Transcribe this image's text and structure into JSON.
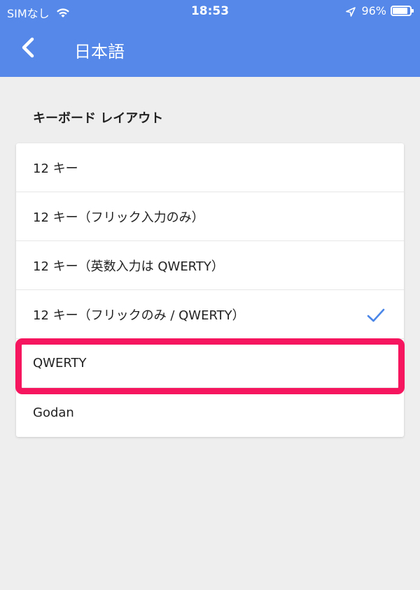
{
  "status_bar": {
    "carrier": "SIMなし",
    "time": "18:53",
    "battery_percent": "96%",
    "battery_level": 0.96,
    "icons": [
      "wifi-icon",
      "location-icon",
      "battery-icon"
    ]
  },
  "app_bar": {
    "title": "日本語",
    "back_icon": "chevron-left-icon"
  },
  "section": {
    "title": "キーボード レイアウト"
  },
  "options": [
    {
      "label": "12 キー",
      "checked": false
    },
    {
      "label": "12 キー（フリック入力のみ）",
      "checked": false
    },
    {
      "label": "12 キー（英数入力は QWERTY）",
      "checked": false
    },
    {
      "label": "12 キー（フリックのみ / QWERTY）",
      "checked": true
    },
    {
      "label": "QWERTY",
      "checked": false
    },
    {
      "label": "Godan",
      "checked": false
    }
  ],
  "colors": {
    "accent": "#5588e8",
    "highlight": "#f5165f",
    "check": "#4a86e8",
    "background": "#eeeeee"
  }
}
